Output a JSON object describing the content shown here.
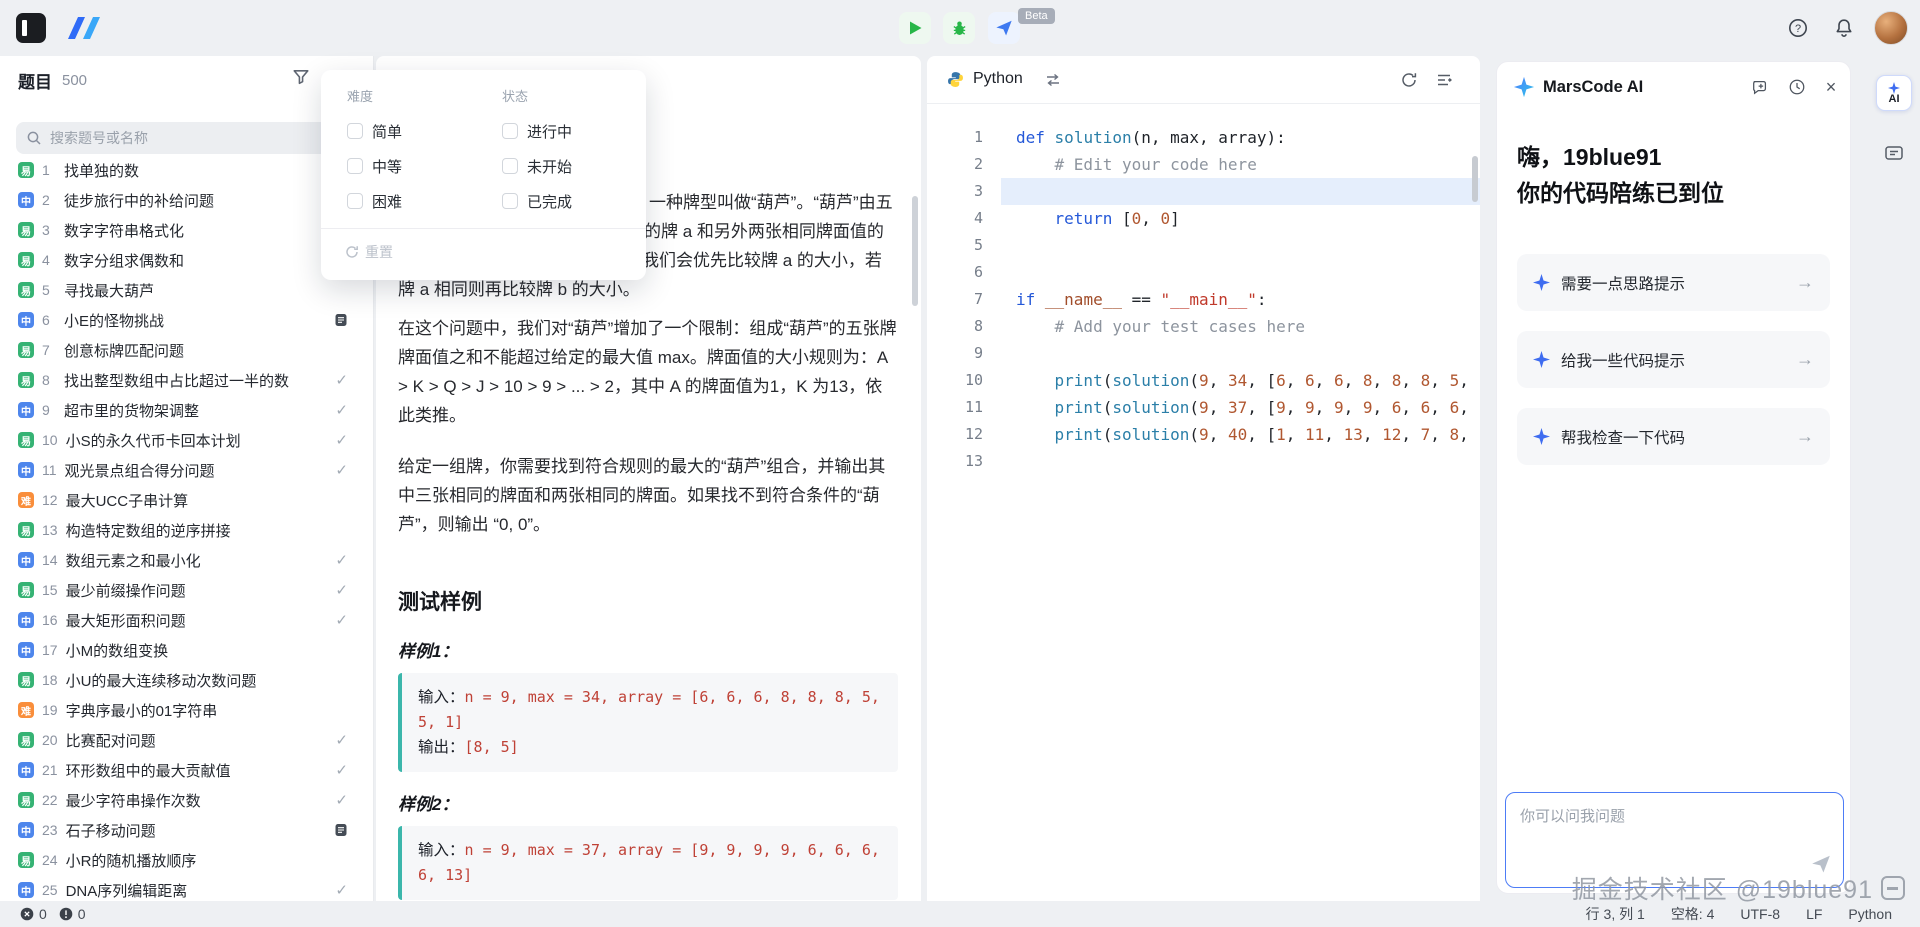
{
  "topbar": {
    "beta_label": "Beta"
  },
  "sidebar": {
    "title": "题目",
    "count": "500",
    "search_placeholder": "搜索题号或名称",
    "problems": [
      {
        "num": "1",
        "title": "找单独的数",
        "level": "easy",
        "badge": "易",
        "right": ""
      },
      {
        "num": "2",
        "title": "徒步旅行中的补给问题",
        "level": "medium",
        "badge": "中",
        "right": ""
      },
      {
        "num": "3",
        "title": "数字字符串格式化",
        "level": "easy",
        "badge": "易",
        "right": ""
      },
      {
        "num": "4",
        "title": "数字分组求偶数和",
        "level": "easy",
        "badge": "易",
        "right": ""
      },
      {
        "num": "5",
        "title": "寻找最大葫芦",
        "level": "easy",
        "badge": "易",
        "right": ""
      },
      {
        "num": "6",
        "title": "小E的怪物挑战",
        "level": "medium",
        "badge": "中",
        "right": "doc"
      },
      {
        "num": "7",
        "title": "创意标牌匹配问题",
        "level": "easy",
        "badge": "易",
        "right": ""
      },
      {
        "num": "8",
        "title": "找出整型数组中占比超过一半的数",
        "level": "easy",
        "badge": "易",
        "right": "check"
      },
      {
        "num": "9",
        "title": "超市里的货物架调整",
        "level": "medium",
        "badge": "中",
        "right": "check"
      },
      {
        "num": "10",
        "title": "小S的永久代币卡回本计划",
        "level": "easy",
        "badge": "易",
        "right": "check"
      },
      {
        "num": "11",
        "title": "观光景点组合得分问题",
        "level": "medium",
        "badge": "中",
        "right": "check"
      },
      {
        "num": "12",
        "title": "最大UCC子串计算",
        "level": "hard",
        "badge": "难",
        "right": ""
      },
      {
        "num": "13",
        "title": "构造特定数组的逆序拼接",
        "level": "easy",
        "badge": "易",
        "right": ""
      },
      {
        "num": "14",
        "title": "数组元素之和最小化",
        "level": "medium",
        "badge": "中",
        "right": "check"
      },
      {
        "num": "15",
        "title": "最少前缀操作问题",
        "level": "easy",
        "badge": "易",
        "right": "check"
      },
      {
        "num": "16",
        "title": "最大矩形面积问题",
        "level": "medium",
        "badge": "中",
        "right": "check"
      },
      {
        "num": "17",
        "title": "小M的数组变换",
        "level": "medium",
        "badge": "中",
        "right": ""
      },
      {
        "num": "18",
        "title": "小U的最大连续移动次数问题",
        "level": "easy",
        "badge": "易",
        "right": ""
      },
      {
        "num": "19",
        "title": "字典序最小的01字符串",
        "level": "hard",
        "badge": "难",
        "right": ""
      },
      {
        "num": "20",
        "title": "比赛配对问题",
        "level": "easy",
        "badge": "易",
        "right": "check"
      },
      {
        "num": "21",
        "title": "环形数组中的最大贡献值",
        "level": "medium",
        "badge": "中",
        "right": "check"
      },
      {
        "num": "22",
        "title": "最少字符串操作次数",
        "level": "easy",
        "badge": "易",
        "right": "check"
      },
      {
        "num": "23",
        "title": "石子移动问题",
        "level": "medium",
        "badge": "中",
        "right": "doc"
      },
      {
        "num": "24",
        "title": "小R的随机播放顺序",
        "level": "easy",
        "badge": "易",
        "right": ""
      },
      {
        "num": "25",
        "title": "DNA序列编辑距离",
        "level": "medium",
        "badge": "中",
        "right": "check"
      }
    ]
  },
  "filter": {
    "difficulty_label": "难度",
    "status_label": "状态",
    "difficulty_options": [
      "简单",
      "中等",
      "困难"
    ],
    "status_options": [
      "进行中",
      "未开始",
      "已完成"
    ],
    "reset_label": "重置"
  },
  "problem": {
    "clipped_lines": [
      "一种牌型叫做“葫芦”。“葫芦”由五",
      "的牌 a 和另外两张相同牌面值的",
      "我们会优先比较牌 a 的大小，若",
      "牌 a 相同则再比较牌 b 的大小。"
    ],
    "para2": "在这个问题中，我们对“葫芦”增加了一个限制：组成“葫芦”的五张牌牌面值之和不能超过给定的最大值 max。牌面值的大小规则为：A > K > Q > J > 10 > 9 > ... > 2，其中 A 的牌面值为1，K 为13，依此类推。",
    "para3": "给定一组牌，你需要找到符合规则的最大的“葫芦”组合，并输出其中三张相同的牌面和两张相同的牌面。如果找不到符合条件的“葫芦”，则输出 “0, 0”。",
    "examples_heading": "测试样例",
    "examples": [
      {
        "label": "样例1：",
        "input_label": "输入：",
        "input": "n = 9, max = 34, array = [6, 6, 6, 8, 8, 8, 5, 5, 1]",
        "output_label": "输出：",
        "output": "[8, 5]"
      },
      {
        "label": "样例2：",
        "input_label": "输入：",
        "input": "n = 9, max = 37, array = [9, 9, 9, 9, 6, 6, 6, 6, 13]",
        "output_label": "",
        "output": ""
      }
    ]
  },
  "editor": {
    "language_label": "Python",
    "active_line": 3,
    "lines": [
      "def solution(n, max, array):",
      "    # Edit your code here",
      "",
      "    return [0, 0]",
      "",
      "",
      "if __name__ == \"__main__\":",
      "    # Add your test cases here",
      "",
      "    print(solution(9, 34, [6, 6, 6, 8, 8, 8, 5,",
      "    print(solution(9, 37, [9, 9, 9, 9, 6, 6, 6,",
      "    print(solution(9, 40, [1, 11, 13, 12, 7, 8,",
      ""
    ]
  },
  "ai": {
    "title": "MarsCode AI",
    "greeting_line1": "嗨，19blue91",
    "greeting_line2": "你的代码陪练已到位",
    "suggestions": [
      "需要一点思路提示",
      "给我一些代码提示",
      "帮我检查一下代码"
    ],
    "input_placeholder": "你可以问我问题",
    "ai_button_label": "AI"
  },
  "watermark": "掘金技术社区 @19blue91",
  "statusbar": {
    "error_count": "0",
    "warning_count": "0",
    "cursor": "行 3, 列 1",
    "indent": "空格: 4",
    "encoding": "UTF-8",
    "eol": "LF",
    "language": "Python"
  },
  "colors": {
    "easy": "#36b374",
    "medium": "#4e86ec",
    "hard": "#f98e3b",
    "accent": "#4d7cf6",
    "example_code": "#bf4136"
  }
}
